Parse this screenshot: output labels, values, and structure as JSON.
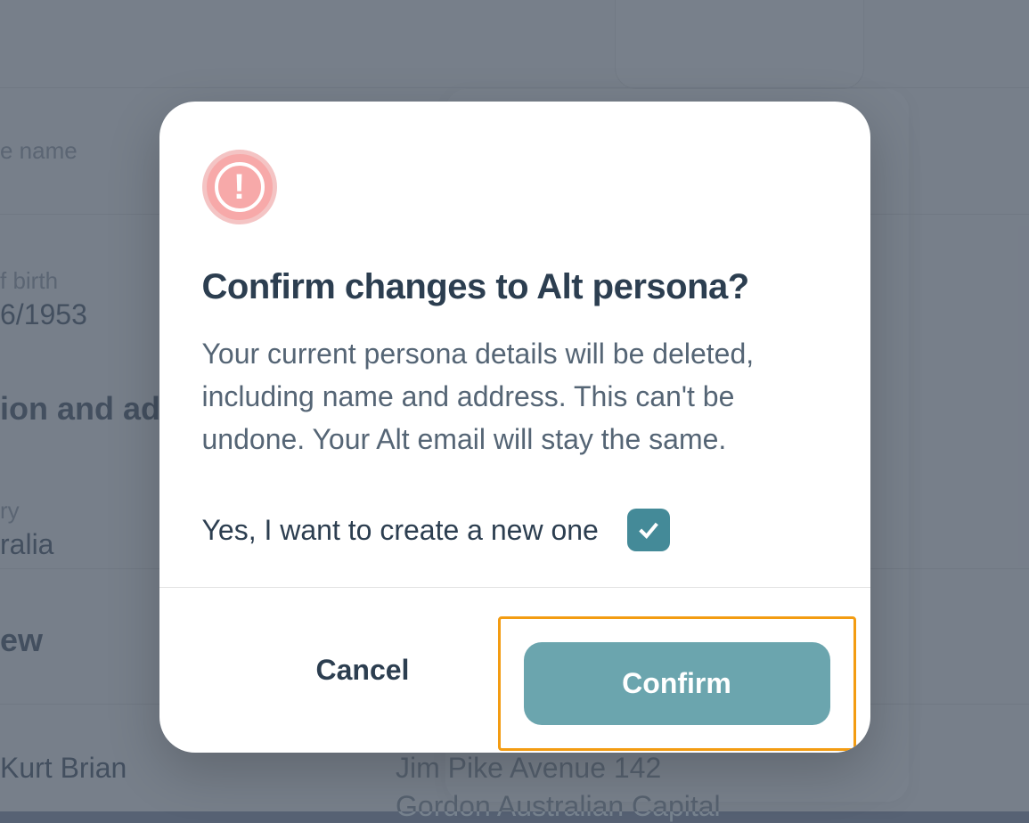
{
  "background": {
    "field_name_label": "e name",
    "field_dob_label": "f birth",
    "field_dob_value": "6/1953",
    "section_heading_1": "ion and ad",
    "field_country_label": "ry",
    "field_country_value": "ralia",
    "section_heading_2": "ew",
    "person_name": "Kurt Brian",
    "address_line_1": "Jim Pike Avenue 142",
    "address_line_2": "Gordon Australian Capital"
  },
  "modal": {
    "title": "Confirm changes to Alt persona?",
    "description": "Your current persona details will be deleted, including name and address. This can't be undone. Your Alt email will stay the same.",
    "checkbox_label": "Yes, I want to create a new one",
    "checkbox_checked": true,
    "cancel_label": "Cancel",
    "confirm_label": "Confirm"
  }
}
